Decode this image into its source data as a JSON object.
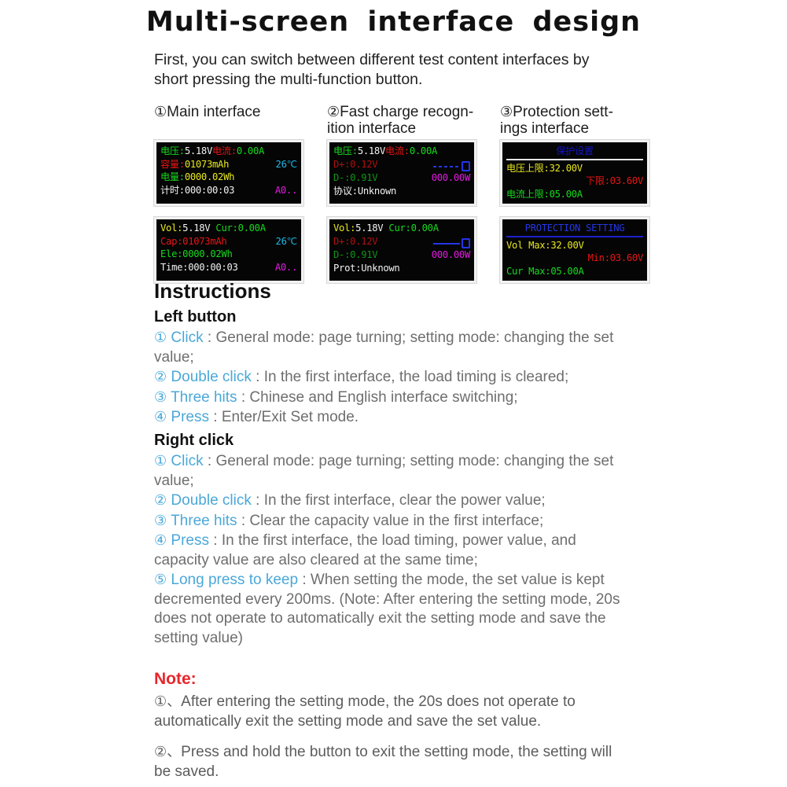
{
  "title": "Multi-screen  interface  design",
  "intro": "First, you can switch between different test content interfaces by short pressing the multi-function button.",
  "colors": {
    "accent_blue": "#4aa8d8",
    "note_red": "#e8262c",
    "lcd_green": "#17d91e",
    "lcd_yellow": "#e8e81d",
    "lcd_red": "#e81515",
    "lcd_cyan": "#1fb8e8",
    "lcd_magenta": "#e01ce0",
    "lcd_blue": "#2436e6",
    "body_gray": "#6e6e6e"
  },
  "screens": {
    "columns": [
      {
        "number": "①",
        "heading": "Main interface",
        "cn": {
          "row1_left_label": "电压:",
          "row1_left_value": "5.18V",
          "row1_right_label": "电流:",
          "row1_right_value": "0.00A",
          "row2_label": "容量:",
          "row2_value": "01073mAh",
          "row2_temp": "26℃",
          "row3_label": "电量:",
          "row3_value": "0000.02Wh",
          "row4_label": "计时:",
          "row4_value": "000:00:03",
          "row4_tag": "A0.."
        },
        "en": {
          "row1_left_label": "Vol:",
          "row1_left_value": "5.18V",
          "row1_right_label": "Cur:",
          "row1_right_value": "0.00A",
          "row2_label": "Cap:",
          "row2_value": "01073mAh",
          "row2_temp": "26℃",
          "row3_label": "Ele:",
          "row3_value": "0000.02Wh",
          "row4_label": "Time:",
          "row4_value": "000:00:03",
          "row4_tag": "A0.."
        }
      },
      {
        "number": "②",
        "heading": "Fast charge recogn-\nition interface",
        "cn": {
          "row1_left_label": "电压:",
          "row1_left_value": "5.18V",
          "row1_right_label": "电流:",
          "row1_right_value": "0.00A",
          "row2_label": "D+:",
          "row2_value": "0.12V",
          "row3_label": "D-:",
          "row3_value": "0.91V",
          "row3_power": "000.00W",
          "row4_label": "协议:",
          "row4_value": "Unknown"
        },
        "en": {
          "row1_left_label": "Vol:",
          "row1_left_value": "5.18V",
          "row1_right_label": "Cur:",
          "row1_right_value": "0.00A",
          "row2_label": "D+:",
          "row2_value": "0.12V",
          "row3_label": "D-:",
          "row3_value": "0.91V",
          "row3_power": "000.00W",
          "row4_label": "Prot:",
          "row4_value": "Unknown"
        }
      },
      {
        "number": "③",
        "heading": "Protection sett-\nings interface",
        "cn": {
          "title": "保护设置",
          "row1_label": "电压上限:",
          "row1_value": "32.00V",
          "row2_label": "下限:",
          "row2_value": "03.60V",
          "row3_label": "电流上限:",
          "row3_value": "05.00A"
        },
        "en": {
          "title": "PROTECTION SETTING",
          "row1_label": "Vol Max:",
          "row1_value": "32.00V",
          "row2_label": "Min:",
          "row2_value": "03.60V",
          "row3_label": "Cur Max:",
          "row3_value": "05.00A"
        }
      }
    ]
  },
  "instructions": {
    "heading": "Instructions",
    "left_button": {
      "heading": "Left button",
      "items": [
        {
          "num": "①",
          "kw": "Click",
          "text": "General mode: page turning; setting mode: changing the set value;"
        },
        {
          "num": "②",
          "kw": "Double click",
          "text": "In the first interface, the load timing is cleared;"
        },
        {
          "num": "③",
          "kw": "Three hits",
          "text": "Chinese and English interface switching;"
        },
        {
          "num": "④",
          "kw": "Press",
          "text": "Enter/Exit Set mode."
        }
      ]
    },
    "right_click": {
      "heading": "Right click",
      "items": [
        {
          "num": "①",
          "kw": "Click",
          "text": "General mode: page turning; setting mode: changing the set value;"
        },
        {
          "num": "②",
          "kw": "Double click",
          "text": "In the first interface, clear the power value;"
        },
        {
          "num": "③",
          "kw": "Three hits",
          "text": "Clear the capacity value in the first interface;"
        },
        {
          "num": "④",
          "kw": "Press",
          "text": "In the first interface, the load timing, power value, and capacity value are also cleared at the same time;"
        },
        {
          "num": "⑤",
          "kw": "Long press to keep",
          "text": "When setting the mode, the set value is kept decremented every 200ms. (Note: After entering the setting mode, 20s does not operate to automatically exit the setting mode and save the setting value)"
        }
      ]
    }
  },
  "note": {
    "heading": "Note:",
    "items": [
      {
        "num": "①、",
        "text": "After entering the setting mode, the 20s does not operate to automatically exit the setting mode and save the set value."
      },
      {
        "num": "②、",
        "text": "Press and hold the button to exit the setting mode, the setting will be saved."
      }
    ]
  },
  "separator": " : "
}
